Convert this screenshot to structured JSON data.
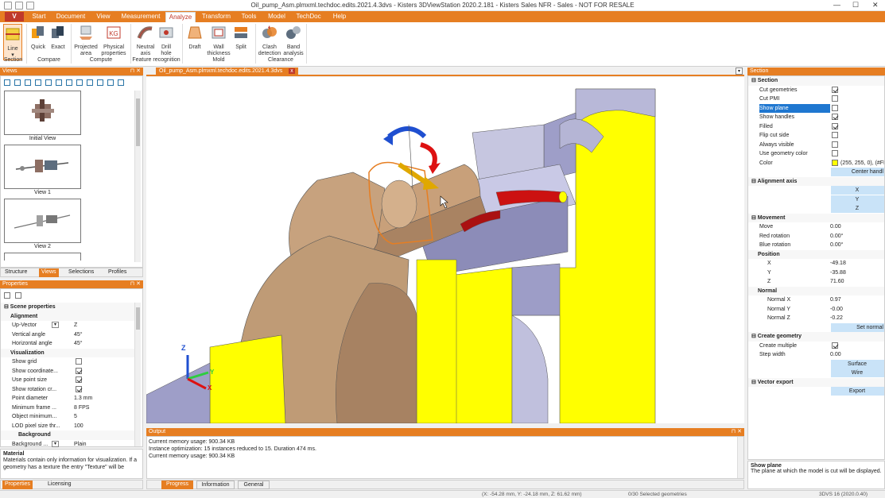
{
  "window": {
    "title": "Oil_pump_Asm.plmxml.techdoc.edits.2021.4.3dvs - Kisters 3DViewStation 2020.2.181 - Kisters Sales NFR - Sales - NOT FOR RESALE",
    "minimize": "—",
    "maximize": "☐",
    "close": "✕",
    "logo": "V"
  },
  "ribbon_tabs": [
    "Start",
    "Document",
    "View",
    "Measurement",
    "Analyze",
    "Transform",
    "Tools",
    "Model",
    "TechDoc",
    "Help"
  ],
  "ribbon": {
    "buttons": [
      {
        "l1": "Line",
        "l2": "▾",
        "name": "section-line"
      },
      {
        "l1": "Quick",
        "l2": "",
        "name": "compare-quick"
      },
      {
        "l1": "Exact",
        "l2": "",
        "name": "compare-exact"
      },
      {
        "l1": "Projected",
        "l2": "area",
        "name": "projected-area"
      },
      {
        "l1": "Physical",
        "l2": "properties",
        "name": "physical-properties"
      },
      {
        "l1": "Neutral",
        "l2": "axis",
        "name": "neutral-axis"
      },
      {
        "l1": "Drill",
        "l2": "hole",
        "name": "drill-hole"
      },
      {
        "l1": "Draft",
        "l2": "",
        "name": "draft"
      },
      {
        "l1": "Wall",
        "l2": "thickness",
        "name": "wall-thickness"
      },
      {
        "l1": "Split",
        "l2": "",
        "name": "split"
      },
      {
        "l1": "Clash",
        "l2": "detection",
        "name": "clash-detection"
      },
      {
        "l1": "Band",
        "l2": "analysis",
        "name": "band-analysis"
      }
    ],
    "groups": [
      "Section",
      "Compare",
      "Compute",
      "Feature recognition",
      "Mold",
      "Clearance"
    ],
    "accent": "#e67e22"
  },
  "views_panel": {
    "title": "Views",
    "pin": "⊓ ✕",
    "items": [
      "Initial View",
      "View 1",
      "View 2"
    ],
    "tabs": [
      "Structure",
      "Views",
      "Selections",
      "Profiles"
    ]
  },
  "properties_panel": {
    "title": "Properties",
    "pin": "⊓ ✕",
    "rows": [
      {
        "k": "Scene properties",
        "v": "",
        "type": "h1"
      },
      {
        "k": "Alignment",
        "v": "",
        "type": "h2"
      },
      {
        "k": "Up-Vector",
        "v": "Z",
        "type": "dd"
      },
      {
        "k": "Vertical angle",
        "v": "45°",
        "type": "t"
      },
      {
        "k": "Horizontal angle",
        "v": "45°",
        "type": "t"
      },
      {
        "k": "Visualization",
        "v": "",
        "type": "h2"
      },
      {
        "k": "Show grid",
        "v": "",
        "type": "cb0"
      },
      {
        "k": "Show coordinate...",
        "v": "",
        "type": "cb1"
      },
      {
        "k": "Use point size",
        "v": "",
        "type": "cb1"
      },
      {
        "k": "Show rotation cr...",
        "v": "",
        "type": "cb1"
      },
      {
        "k": "Point diameter",
        "v": "1.3 mm",
        "type": "t"
      },
      {
        "k": "Minimum frame ...",
        "v": "8 FPS",
        "type": "t"
      },
      {
        "k": "Object minimum...",
        "v": "5",
        "type": "t"
      },
      {
        "k": "LOD pixel size thr...",
        "v": "100",
        "type": "t"
      },
      {
        "k": "Background",
        "v": "",
        "type": "h3"
      },
      {
        "k": "Background ...",
        "v": "Plain",
        "type": "dd"
      }
    ],
    "info_title": "Material",
    "info_text": "Materials contain only information for visualization. If a geometry has a texture the entry \"Texture\" will be",
    "tabs": [
      "Properties",
      "Licensing"
    ]
  },
  "document_tab": {
    "name": "Oil_pump_Asm.plmxml.techdoc.edits.2021.4.3dvs",
    "close": "x"
  },
  "viewport": {
    "bg": "#ffffff",
    "axes": {
      "x": "X",
      "y": "Y",
      "z": "Z"
    }
  },
  "output_panel": {
    "title": "Output",
    "pin": "⊓ ✕",
    "lines": [
      "Current memory usage: 900.34 KB",
      "Instance optimization: 15 instances reduced to 15. Duration 474 ms.",
      "Current memory usage: 900.34 KB"
    ],
    "tabs": [
      "Progress",
      "Information",
      "General"
    ]
  },
  "section_panel": {
    "title": "Section",
    "rows": [
      {
        "k": "Section",
        "v": "",
        "type": "h1"
      },
      {
        "k": "Cut geometries",
        "v": "",
        "type": "cb1"
      },
      {
        "k": "Cut PMI",
        "v": "",
        "type": "cb0"
      },
      {
        "k": "Show plane",
        "v": "",
        "type": "cb0sel"
      },
      {
        "k": "Show handles",
        "v": "",
        "type": "cb1"
      },
      {
        "k": "Filled",
        "v": "",
        "type": "cb1"
      },
      {
        "k": "Flip cut side",
        "v": "",
        "type": "cb0"
      },
      {
        "k": "Always visible",
        "v": "",
        "type": "cb0"
      },
      {
        "k": "Use geometry color",
        "v": "",
        "type": "cb0"
      },
      {
        "k": "Color",
        "v": "(255, 255, 0), (#FF",
        "type": "color"
      },
      {
        "k": "",
        "v": "Center handl",
        "type": "btnr"
      },
      {
        "k": "Alignment axis",
        "v": "",
        "type": "h1"
      },
      {
        "k": "",
        "v": "X",
        "type": "btnc"
      },
      {
        "k": "",
        "v": "Y",
        "type": "btnc"
      },
      {
        "k": "",
        "v": "Z",
        "type": "btnc"
      },
      {
        "k": "Movement",
        "v": "",
        "type": "h1"
      },
      {
        "k": "Move",
        "v": "0.00",
        "type": "t"
      },
      {
        "k": "Red rotation",
        "v": "0.00°",
        "type": "t"
      },
      {
        "k": "Blue rotation",
        "v": "0.00°",
        "type": "t"
      },
      {
        "k": "Position",
        "v": "",
        "type": "h2"
      },
      {
        "k": "X",
        "v": "-49.18",
        "type": "t2"
      },
      {
        "k": "Y",
        "v": "-35.88",
        "type": "t2"
      },
      {
        "k": "Z",
        "v": "71.60",
        "type": "t2"
      },
      {
        "k": "Normal",
        "v": "",
        "type": "h2"
      },
      {
        "k": "Normal X",
        "v": "0.97",
        "type": "t2"
      },
      {
        "k": "Normal Y",
        "v": "-0.00",
        "type": "t2"
      },
      {
        "k": "Normal Z",
        "v": "-0.22",
        "type": "t2"
      },
      {
        "k": "",
        "v": "Set normal",
        "type": "btnr"
      },
      {
        "k": "Create geometry",
        "v": "",
        "type": "h1"
      },
      {
        "k": "Create multiple",
        "v": "",
        "type": "cb1"
      },
      {
        "k": "Step width",
        "v": "0.00",
        "type": "t"
      },
      {
        "k": "",
        "v": "Surface",
        "type": "btnc"
      },
      {
        "k": "",
        "v": "Wire",
        "type": "btnc"
      },
      {
        "k": "Vector export",
        "v": "",
        "type": "h1"
      },
      {
        "k": "",
        "v": "Export",
        "type": "btnc"
      }
    ],
    "help_title": "Show plane",
    "help_text": "The plane at which the model is cut will be displayed."
  },
  "status_bar": {
    "coords": "(X: -54.28 mm, Y: -24.18 mm, Z: 61.62 mm)",
    "selection": "0/30 Selected geometries",
    "version": "3DVS 16 (2020.0.40)"
  }
}
